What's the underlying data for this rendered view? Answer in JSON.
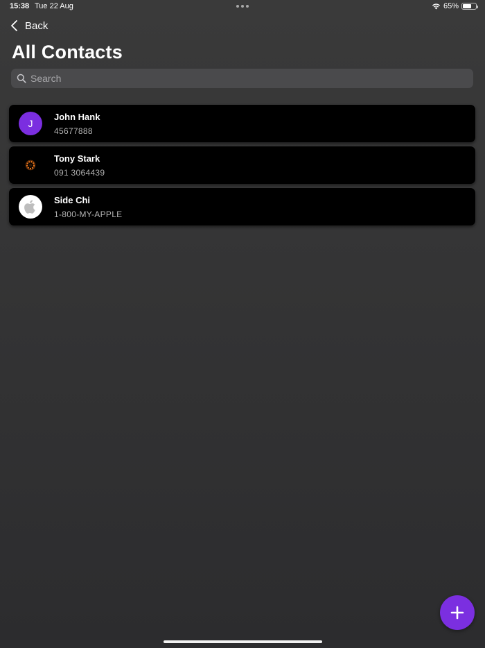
{
  "status_bar": {
    "time": "15:38",
    "date": "Tue 22 Aug",
    "battery_percent": "65%",
    "battery_level": 0.65
  },
  "nav": {
    "back_label": "Back"
  },
  "page": {
    "title": "All Contacts"
  },
  "search": {
    "placeholder": "Search",
    "value": ""
  },
  "contacts": [
    {
      "name": "John Hank",
      "phone": "45677888",
      "avatar_type": "letter",
      "avatar_letter": "J"
    },
    {
      "name": "Tony Stark",
      "phone": "091 3064439",
      "avatar_type": "image",
      "avatar_icon": "arc-reactor-icon"
    },
    {
      "name": "Side Chi",
      "phone": "1-800-MY-APPLE",
      "avatar_type": "image",
      "avatar_icon": "apple-logo-icon"
    }
  ],
  "colors": {
    "accent": "#7b2fe0",
    "card_background": "#000000",
    "search_background": "#4a4a4c"
  },
  "fab": {
    "icon": "plus-icon"
  }
}
